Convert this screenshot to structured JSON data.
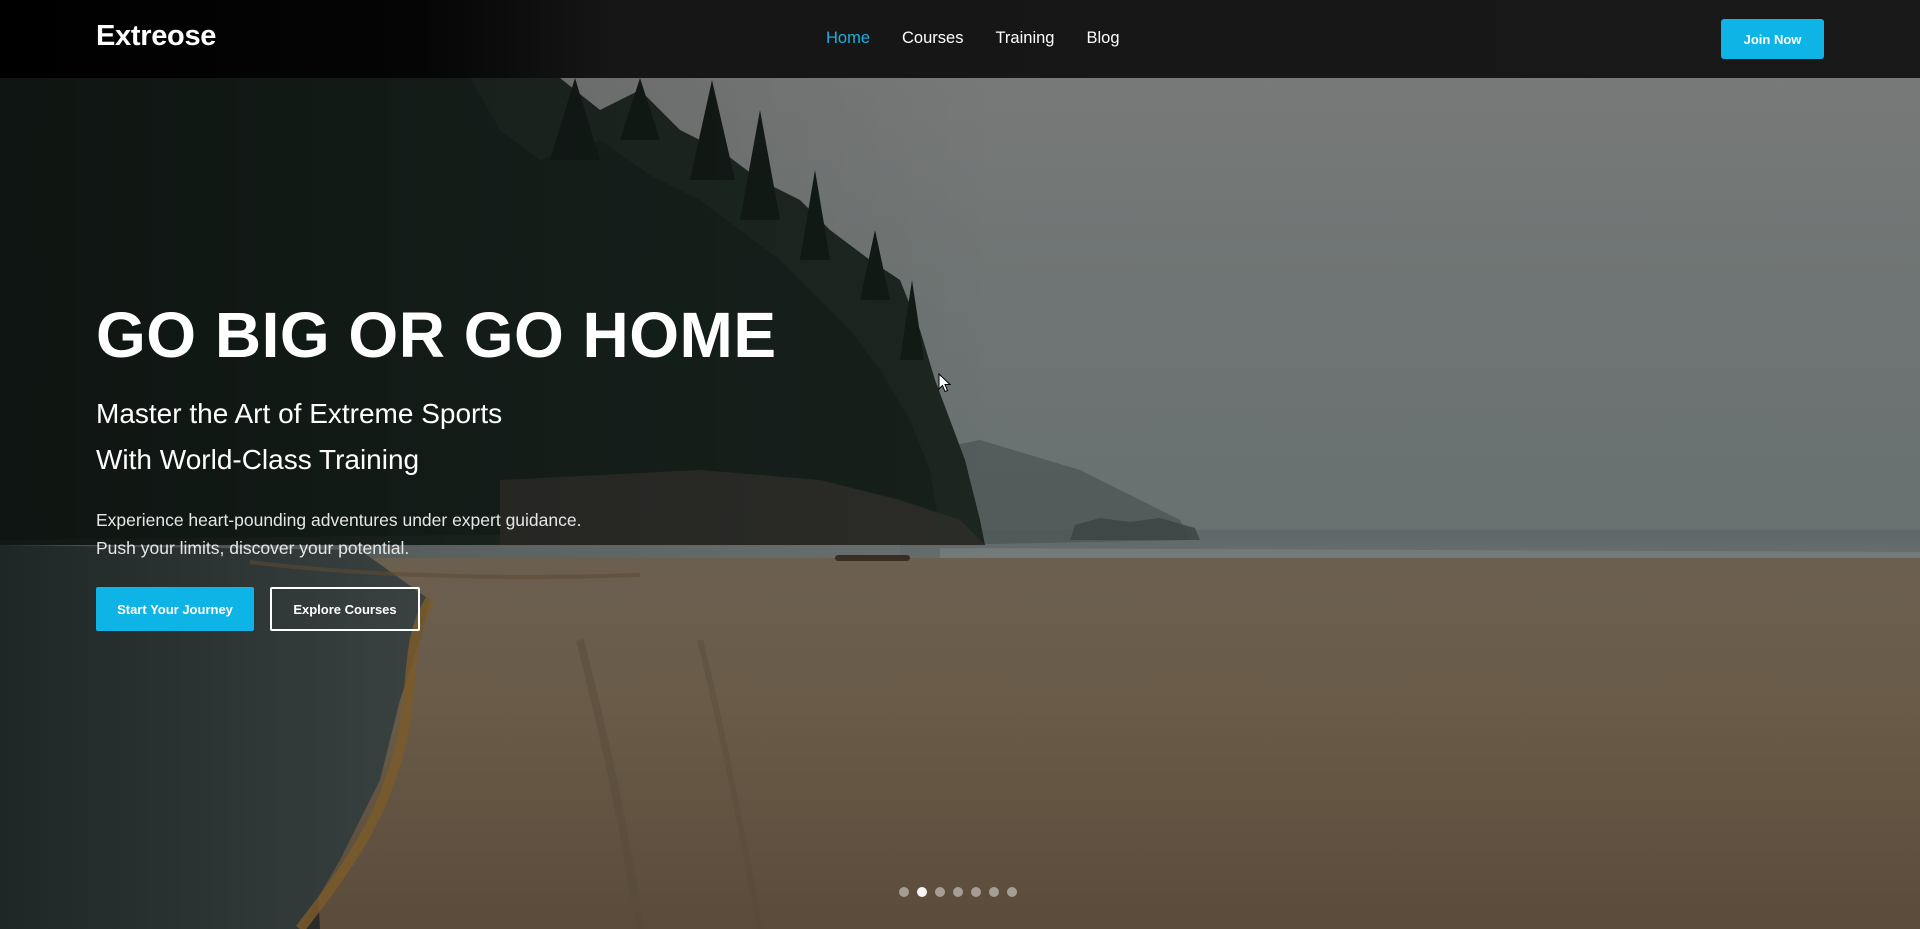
{
  "header": {
    "logo": "Extreose",
    "nav": [
      {
        "label": "Home",
        "active": true
      },
      {
        "label": "Courses",
        "active": false
      },
      {
        "label": "Training",
        "active": false
      },
      {
        "label": "Blog",
        "active": false
      }
    ],
    "join_label": "Join Now"
  },
  "hero": {
    "title": "GO BIG OR GO HOME",
    "subtitle_line1": "Master the Art of Extreme Sports",
    "subtitle_line2": "With World-Class Training",
    "description_line1": "Experience heart-pounding adventures under expert guidance.",
    "description_line2": "Push your limits, discover your potential.",
    "primary_button": "Start Your Journey",
    "secondary_button": "Explore Courses",
    "background_image": "misty forested headland above a sandy beach with shoreline"
  },
  "slider": {
    "total": 7,
    "active_index": 1
  },
  "colors": {
    "accent": "#0fb4e6",
    "nav_active": "#1ab0e0",
    "header_bg": "#181818",
    "text": "#ffffff"
  },
  "icons": {
    "cursor": "mouse-pointer-icon"
  }
}
